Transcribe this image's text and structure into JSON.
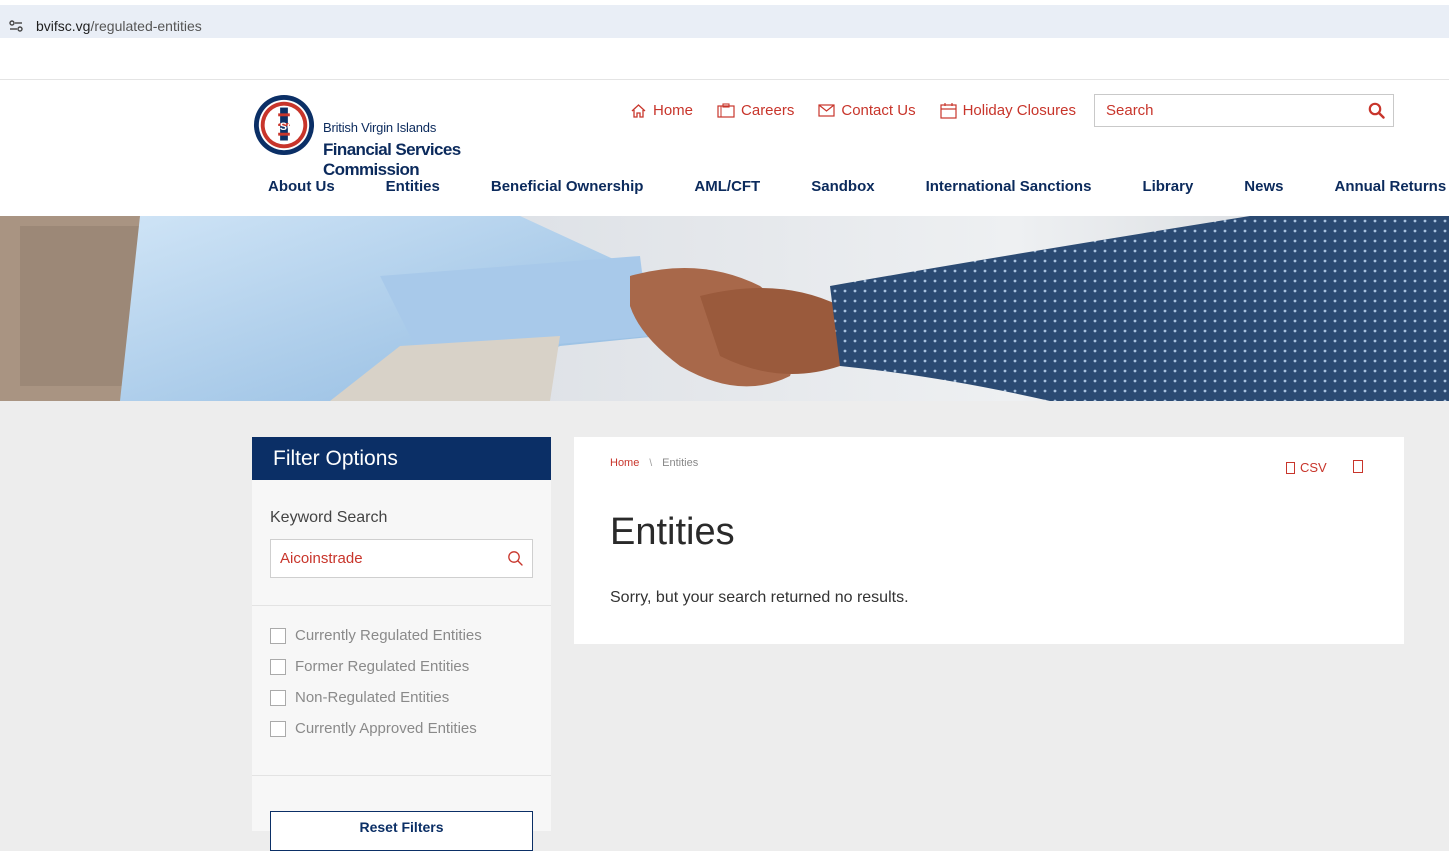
{
  "browser": {
    "url_host": "bvifsc.vg",
    "url_path": "/regulated-entities"
  },
  "logo": {
    "seal_text": "FSC",
    "line1": "British Virgin Islands",
    "line2": "Financial Services Commission"
  },
  "utility_links": [
    {
      "label": "Home",
      "icon": "home-icon"
    },
    {
      "label": "Careers",
      "icon": "briefcase-icon"
    },
    {
      "label": "Contact Us",
      "icon": "envelope-icon"
    },
    {
      "label": "Holiday Closures",
      "icon": "calendar-icon"
    }
  ],
  "search": {
    "placeholder": "Search"
  },
  "main_nav": [
    "About Us",
    "Entities",
    "Beneficial Ownership",
    "AML/CFT",
    "Sandbox",
    "International Sanctions",
    "Library",
    "News",
    "Annual Returns"
  ],
  "sidebar": {
    "title": "Filter Options",
    "keyword_label": "Keyword Search",
    "keyword_value": "Aicoinstrade",
    "checkboxes": [
      "Currently Regulated Entities",
      "Former Regulated Entities",
      "Non-Regulated Entities",
      "Currently Approved Entities"
    ],
    "reset_label": "Reset Filters"
  },
  "breadcrumb": {
    "home": "Home",
    "separator": "\\",
    "current": "Entities"
  },
  "panel": {
    "csv_label": "CSV",
    "title": "Entities",
    "message": "Sorry, but your search returned no results."
  },
  "colors": {
    "brand_navy": "#0b2f66",
    "accent_red": "#c8352b",
    "page_bg": "#ededed"
  }
}
